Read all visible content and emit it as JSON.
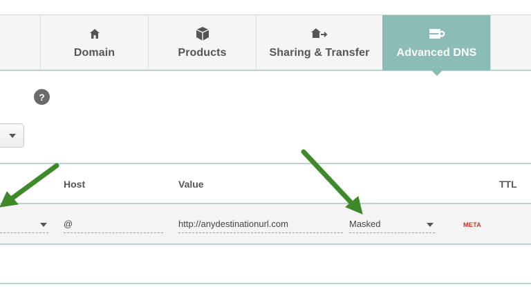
{
  "tabs": [
    {
      "label": "Domain",
      "icon": "home-icon",
      "active": false
    },
    {
      "label": "Products",
      "icon": "box-icon",
      "active": false
    },
    {
      "label": "Sharing & Transfer",
      "icon": "share-transfer-icon",
      "active": false
    },
    {
      "label": "Advanced DNS",
      "icon": "server-icon",
      "active": true
    }
  ],
  "help": {
    "symbol": "?"
  },
  "table": {
    "columns": {
      "host": "Host",
      "value": "Value",
      "ttl": "TTL"
    },
    "row": {
      "host": "@",
      "value": "http://anydestinationurl.com",
      "redirect_type": "Masked",
      "meta": "META"
    }
  },
  "colors": {
    "accent": "#8bbcb6",
    "arrow": "#3e8a2a",
    "meta": "#c0392b"
  }
}
